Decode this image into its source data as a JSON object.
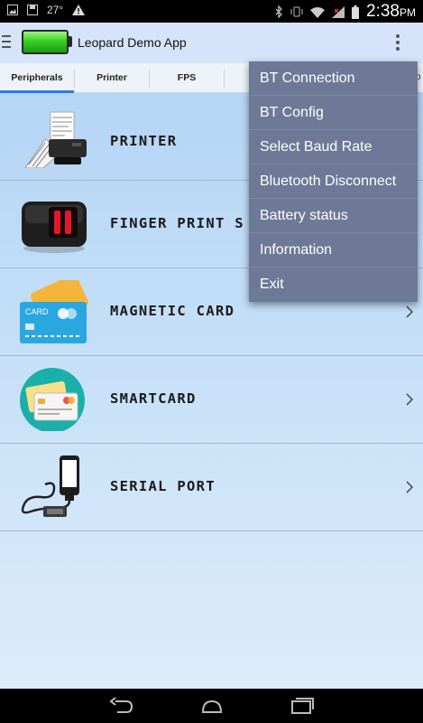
{
  "status_bar": {
    "temperature": "27°",
    "time": "2:38",
    "time_suffix": "PM"
  },
  "app_bar": {
    "title": "Leopard Demo App"
  },
  "tabs": [
    {
      "label": "Peripherals",
      "active": true
    },
    {
      "label": "Printer",
      "active": false
    },
    {
      "label": "FPS",
      "active": false
    },
    {
      "label": "",
      "active": false
    },
    {
      "label": "",
      "active": false
    }
  ],
  "tab_overflow": "o",
  "list": [
    {
      "label": "PRINTER",
      "icon": "printer-icon"
    },
    {
      "label": "FINGER PRINT S",
      "icon": "fingerprint-scanner-icon"
    },
    {
      "label": "MAGNETIC CARD",
      "icon": "credit-card-icon"
    },
    {
      "label": "SMARTCARD",
      "icon": "smartcard-icon"
    },
    {
      "label": "SERIAL PORT",
      "icon": "serial-cable-icon"
    }
  ],
  "menu": [
    "BT Connection",
    "BT Config",
    "Select Baud Rate",
    "Bluetooth Disconnect",
    "Battery status",
    "Information",
    "Exit"
  ],
  "colors": {
    "app_bar": "#d5e4fa",
    "tab_indicator": "#2a7be0",
    "menu_bg": "#6d7996",
    "battery": "#39d023"
  }
}
